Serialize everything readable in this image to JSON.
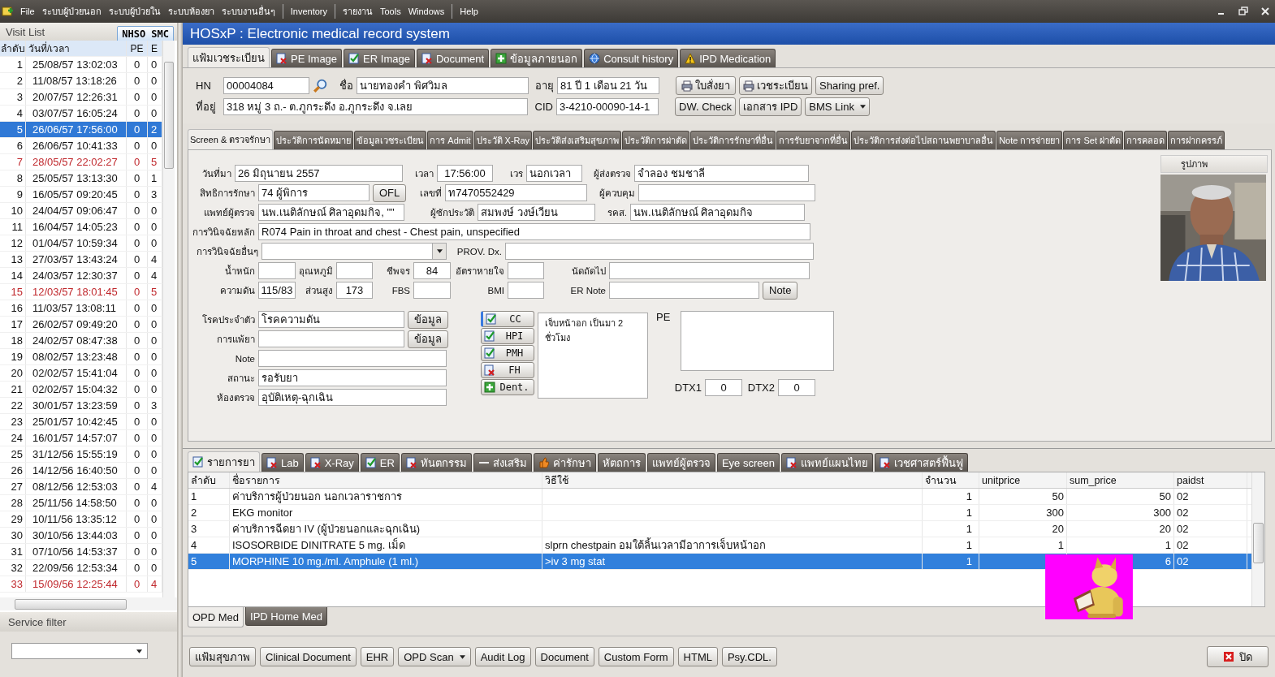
{
  "menu": [
    [
      "File",
      "ระบบผู้ป่วยนอก",
      "ระบบผู้ป่วยใน",
      "ระบบห้องยา",
      "ระบบงานอื่นๆ"
    ],
    [
      "Inventory"
    ],
    [
      "รายงาน",
      "Tools",
      "Windows"
    ],
    [
      "Help"
    ]
  ],
  "visit_list": {
    "title": "Visit List",
    "nhso_button": "NHSO SMC",
    "columns": [
      "ลำดับ",
      "วันที่/เวลา",
      "PE",
      "E"
    ],
    "rows": [
      {
        "no": "1",
        "datetime": "25/08/57 13:02:03",
        "pe": "0",
        "er": "0",
        "highlighted": false,
        "selected": false
      },
      {
        "no": "2",
        "datetime": "11/08/57 13:18:26",
        "pe": "0",
        "er": "0",
        "highlighted": false,
        "selected": false
      },
      {
        "no": "3",
        "datetime": "20/07/57 12:26:31",
        "pe": "0",
        "er": "0",
        "highlighted": false,
        "selected": false
      },
      {
        "no": "4",
        "datetime": "03/07/57 16:05:24",
        "pe": "0",
        "er": "0",
        "highlighted": false,
        "selected": false
      },
      {
        "no": "5",
        "datetime": "26/06/57 17:56:00",
        "pe": "0",
        "er": "2",
        "highlighted": false,
        "selected": true
      },
      {
        "no": "6",
        "datetime": "26/06/57 10:41:33",
        "pe": "0",
        "er": "0",
        "highlighted": false,
        "selected": false
      },
      {
        "no": "7",
        "datetime": "28/05/57 22:02:27",
        "pe": "0",
        "er": "5",
        "highlighted": true,
        "selected": false
      },
      {
        "no": "8",
        "datetime": "25/05/57 13:13:30",
        "pe": "0",
        "er": "1",
        "highlighted": false,
        "selected": false
      },
      {
        "no": "9",
        "datetime": "16/05/57 09:20:45",
        "pe": "0",
        "er": "3",
        "highlighted": false,
        "selected": false
      },
      {
        "no": "10",
        "datetime": "24/04/57 09:06:47",
        "pe": "0",
        "er": "0",
        "highlighted": false,
        "selected": false
      },
      {
        "no": "11",
        "datetime": "16/04/57 14:05:23",
        "pe": "0",
        "er": "0",
        "highlighted": false,
        "selected": false
      },
      {
        "no": "12",
        "datetime": "01/04/57 10:59:34",
        "pe": "0",
        "er": "0",
        "highlighted": false,
        "selected": false
      },
      {
        "no": "13",
        "datetime": "27/03/57 13:43:24",
        "pe": "0",
        "er": "4",
        "highlighted": false,
        "selected": false
      },
      {
        "no": "14",
        "datetime": "24/03/57 12:30:37",
        "pe": "0",
        "er": "4",
        "highlighted": false,
        "selected": false
      },
      {
        "no": "15",
        "datetime": "12/03/57 18:01:45",
        "pe": "0",
        "er": "5",
        "highlighted": true,
        "selected": false
      },
      {
        "no": "16",
        "datetime": "11/03/57 13:08:11",
        "pe": "0",
        "er": "0",
        "highlighted": false,
        "selected": false
      },
      {
        "no": "17",
        "datetime": "26/02/57 09:49:20",
        "pe": "0",
        "er": "0",
        "highlighted": false,
        "selected": false
      },
      {
        "no": "18",
        "datetime": "24/02/57 08:47:38",
        "pe": "0",
        "er": "0",
        "highlighted": false,
        "selected": false
      },
      {
        "no": "19",
        "datetime": "08/02/57 13:23:48",
        "pe": "0",
        "er": "0",
        "highlighted": false,
        "selected": false
      },
      {
        "no": "20",
        "datetime": "02/02/57 15:41:04",
        "pe": "0",
        "er": "0",
        "highlighted": false,
        "selected": false
      },
      {
        "no": "21",
        "datetime": "02/02/57 15:04:32",
        "pe": "0",
        "er": "0",
        "highlighted": false,
        "selected": false
      },
      {
        "no": "22",
        "datetime": "30/01/57 13:23:59",
        "pe": "0",
        "er": "3",
        "highlighted": false,
        "selected": false
      },
      {
        "no": "23",
        "datetime": "25/01/57 10:42:45",
        "pe": "0",
        "er": "0",
        "highlighted": false,
        "selected": false
      },
      {
        "no": "24",
        "datetime": "16/01/57 14:57:07",
        "pe": "0",
        "er": "0",
        "highlighted": false,
        "selected": false
      },
      {
        "no": "25",
        "datetime": "31/12/56 15:55:19",
        "pe": "0",
        "er": "0",
        "highlighted": false,
        "selected": false
      },
      {
        "no": "26",
        "datetime": "14/12/56 16:40:50",
        "pe": "0",
        "er": "0",
        "highlighted": false,
        "selected": false
      },
      {
        "no": "27",
        "datetime": "08/12/56 12:53:03",
        "pe": "0",
        "er": "4",
        "highlighted": false,
        "selected": false
      },
      {
        "no": "28",
        "datetime": "25/11/56 14:58:50",
        "pe": "0",
        "er": "0",
        "highlighted": false,
        "selected": false
      },
      {
        "no": "29",
        "datetime": "10/11/56 13:35:12",
        "pe": "0",
        "er": "0",
        "highlighted": false,
        "selected": false
      },
      {
        "no": "30",
        "datetime": "30/10/56 13:44:03",
        "pe": "0",
        "er": "0",
        "highlighted": false,
        "selected": false
      },
      {
        "no": "31",
        "datetime": "07/10/56 14:53:37",
        "pe": "0",
        "er": "0",
        "highlighted": false,
        "selected": false
      },
      {
        "no": "32",
        "datetime": "22/09/56 12:53:34",
        "pe": "0",
        "er": "0",
        "highlighted": false,
        "selected": false
      },
      {
        "no": "33",
        "datetime": "15/09/56 12:25:44",
        "pe": "0",
        "er": "4",
        "highlighted": true,
        "selected": false
      }
    ],
    "filter_title": "Service filter"
  },
  "window": {
    "title": "HOSxP :  Electronic medical record system"
  },
  "top_tabs": [
    {
      "label": "แฟ้มเวชระเบียน",
      "kind": "plain",
      "selected": true
    },
    {
      "label": "PE Image",
      "kind": "cross",
      "selected": false
    },
    {
      "label": "ER Image",
      "kind": "check",
      "selected": false
    },
    {
      "label": "Document",
      "kind": "cross",
      "selected": false
    },
    {
      "label": "ข้อมูลภายนอก",
      "kind": "plus",
      "selected": false
    },
    {
      "label": "Consult history",
      "kind": "globe",
      "selected": false
    },
    {
      "label": "IPD Medication",
      "kind": "warning",
      "selected": false
    }
  ],
  "patient": {
    "hn_label": "HN",
    "hn": "00004084",
    "name_label": "ชื่อ",
    "name": "นายทองคำ  พิศวิมล",
    "age_label": "อายุ",
    "age": "81 ปี 1 เดือน 21 วัน",
    "address_label": "ที่อยู่",
    "address": "318 หมู่ 3 ถ.- ต.ภูกระดึง  อ.ภูกระดึง จ.เลย",
    "cid_label": "CID",
    "cid": "3-4210-00090-14-1",
    "buttons": [
      {
        "label": "ใบสั่งยา",
        "kind": "print"
      },
      {
        "label": "เวชระเบียน",
        "kind": "print"
      },
      {
        "label": "Sharing pref.",
        "kind": "plain"
      },
      {
        "label": "DW. Check",
        "kind": "plain"
      },
      {
        "label": "เอกสาร IPD",
        "kind": "plain"
      },
      {
        "label": "BMS Link",
        "kind": "menu"
      }
    ]
  },
  "section_tabs": [
    {
      "label": "Screen & ตรวจรักษา",
      "selected": true
    },
    {
      "label": "ประวัติการนัดหมาย",
      "selected": false
    },
    {
      "label": "ข้อมูลเวชระเบียน",
      "selected": false
    },
    {
      "label": "การ Admit",
      "selected": false
    },
    {
      "label": "ประวัติ X-Ray",
      "selected": false
    },
    {
      "label": "ประวัติส่งเสริมสุขภาพ",
      "selected": false
    },
    {
      "label": "ประวัติการผ่าตัด",
      "selected": false
    },
    {
      "label": "ประวัติการรักษาที่อื่น",
      "selected": false
    },
    {
      "label": "การรับยาจากที่อื่น",
      "selected": false
    },
    {
      "label": "ประวัติการส่งต่อไปสถานพยาบาลอื่น",
      "selected": false
    },
    {
      "label": "Note การจ่ายยา",
      "selected": false
    },
    {
      "label": "การ Set ผ่าตัด",
      "selected": false
    },
    {
      "label": "การคลอด",
      "selected": false
    },
    {
      "label": "การฝากครรภ์",
      "selected": false
    }
  ],
  "form": {
    "rows": [
      [
        {
          "label": "วันที่มา",
          "value": "26 มิถุนายน 2557",
          "kind": "text"
        },
        {
          "label": "เวลา",
          "value": "17:56:00",
          "kind": "center"
        },
        {
          "label": "เวร",
          "value": "นอกเวลา",
          "kind": "text"
        },
        {
          "label": "ผู้ส่งตรวจ",
          "value": "จำลอง  ชมชาลี",
          "kind": "text"
        }
      ],
      [
        {
          "label": "สิทธิการรักษา",
          "value": "74 ผู้พิการ",
          "kind": "text",
          "button": "OFL"
        },
        {
          "label": "เลขที่",
          "value": "ท7470552429",
          "kind": "text"
        },
        {
          "label": "ผู้ควบคุม",
          "kind": "text"
        }
      ],
      [
        {
          "label": "แพทย์ผู้ตรวจ",
          "value": "นพ.เนติลักษณ์ ศิลาอุดมกิจ, \"\"",
          "kind": "text"
        },
        {
          "label": "ผู้ซักประวัติ",
          "value": "สมพงษ์ วงษ์เวียน",
          "kind": "text"
        },
        {
          "label": "รคส.",
          "value": "นพ.เนติลักษณ์ ศิลาอุดมกิจ",
          "kind": "text"
        }
      ],
      [
        {
          "label": "การวินิจฉัยหลัก",
          "value": "R074 Pain in throat and chest - Chest pain, unspecified",
          "kind": "text"
        }
      ],
      [
        {
          "label": "การวินิจฉัยอื่นๆ",
          "kind": "dropdown"
        },
        {
          "label": "PROV. Dx.",
          "kind": "text"
        }
      ],
      [
        {
          "label": "น้ำหนัก",
          "kind": "text"
        },
        {
          "label": "อุณหภูมิ",
          "kind": "text"
        },
        {
          "label": "ชีพจร",
          "value": "84",
          "kind": "center"
        },
        {
          "label": "อัตราหายใจ",
          "kind": "text"
        },
        {
          "label": "นัดถัดไป",
          "kind": "text"
        }
      ],
      [
        {
          "label": "ความดัน",
          "value": "115/83",
          "kind": "center"
        },
        {
          "label": "ส่วนสูง",
          "value": "173",
          "kind": "center"
        },
        {
          "label": "FBS",
          "kind": "text"
        },
        {
          "label": "BMI",
          "kind": "text"
        },
        {
          "label": "ER Note",
          "kind": "text",
          "button": "Note"
        }
      ]
    ],
    "details": [
      {
        "label": "โรคประจำตัว",
        "value": "โรคความดัน",
        "button": "ข้อมูล"
      },
      {
        "label": "การแพ้ยา",
        "button": "ข้อมูล"
      },
      {
        "label": "Note"
      },
      {
        "label": "สถานะ",
        "value": "รอรับยา"
      },
      {
        "label": "ห้องตรวจ",
        "value": "อุบัติเหตุ-ฉุกเฉิน"
      }
    ],
    "sections": [
      {
        "label": "CC",
        "kind": "check",
        "selected": true
      },
      {
        "label": "HPI",
        "kind": "check",
        "selected": false
      },
      {
        "label": "PMH",
        "kind": "check",
        "selected": false
      },
      {
        "label": "FH",
        "kind": "cross",
        "selected": false
      },
      {
        "label": "Dent.",
        "kind": "plus",
        "selected": false
      }
    ],
    "note": "เจ็บหน้าอก เป็นมา  2 ชั่วโมง",
    "pe_label": "PE",
    "dtx": [
      {
        "label": "DTX1",
        "value": "0"
      },
      {
        "label": "DTX2",
        "value": "0"
      }
    ],
    "photo_label": "รูปภาพ"
  },
  "order_tabs": [
    {
      "label": "รายการยา",
      "kind": "check",
      "selected": true
    },
    {
      "label": "Lab",
      "kind": "cross",
      "selected": false
    },
    {
      "label": "X-Ray",
      "kind": "cross",
      "selected": false
    },
    {
      "label": "ER",
      "kind": "check",
      "selected": false
    },
    {
      "label": "ทันตกรรม",
      "kind": "cross",
      "selected": false
    },
    {
      "label": "ส่งเสริม",
      "kind": "dash",
      "selected": false
    },
    {
      "label": "ค่ารักษา",
      "kind": "hand",
      "selected": false
    },
    {
      "label": "หัตถการ",
      "kind": "plain",
      "selected": false
    },
    {
      "label": "แพทย์ผู้ตรวจ",
      "kind": "plain",
      "selected": false
    },
    {
      "label": "Eye screen",
      "kind": "plain",
      "selected": false
    },
    {
      "label": "แพทย์แผนไทย",
      "kind": "cross",
      "selected": false
    },
    {
      "label": "เวชศาสตร์ฟื้นฟู",
      "kind": "cross",
      "selected": false
    }
  ],
  "table": {
    "columns": [
      "ลำดับ",
      "ชื่อรายการ",
      "วิธีใช้",
      "จำนวน",
      "unitprice",
      "sum_price",
      "paidst"
    ],
    "rows": [
      {
        "no": "1",
        "name": "ค่าบริการผู้ป่วยนอก นอกเวลาราชการ",
        "qty": "1",
        "unitprice": "50",
        "sum_price": "50",
        "paidst": "02",
        "selected": false
      },
      {
        "no": "2",
        "name": "EKG monitor",
        "qty": "1",
        "unitprice": "300",
        "sum_price": "300",
        "paidst": "02",
        "selected": false
      },
      {
        "no": "3",
        "name": "ค่าบริการฉีดยา IV (ผู้ป่วยนอกและฉุกเฉิน)",
        "qty": "1",
        "unitprice": "20",
        "sum_price": "20",
        "paidst": "02",
        "selected": false
      },
      {
        "no": "4",
        "name": "ISOSORBIDE DINITRATE 5 mg. เม็ด",
        "usage": "slprn chestpain อมใต้ลิ้นเวลามีอาการเจ็บหน้าอก",
        "qty": "1",
        "unitprice": "1",
        "sum_price": "1",
        "paidst": "02",
        "selected": false
      },
      {
        "no": "5",
        "name": "MORPHINE 10 mg./ml. Amphule (1 ml.)",
        "usage": ">iv 3 mg stat",
        "qty": "1",
        "sum_price": "6",
        "paidst": "02",
        "selected": true
      }
    ]
  },
  "med_tabs": [
    {
      "label": "OPD Med",
      "selected": true
    },
    {
      "label": "IPD Home Med",
      "selected": false
    }
  ],
  "bottom_buttons": [
    {
      "label": "แฟ้มสุขภาพ",
      "kind": "plain"
    },
    {
      "label": "Clinical Document",
      "kind": "plain"
    },
    {
      "label": "EHR",
      "kind": "plain"
    },
    {
      "label": "OPD Scan",
      "kind": "menu"
    },
    {
      "label": "Audit Log",
      "kind": "plain"
    },
    {
      "label": "Document",
      "kind": "plain"
    },
    {
      "label": "Custom Form",
      "kind": "plain"
    },
    {
      "label": "HTML",
      "kind": "plain"
    },
    {
      "label": "Psy.CDL.",
      "kind": "plain"
    }
  ],
  "close_button": "ปิด"
}
